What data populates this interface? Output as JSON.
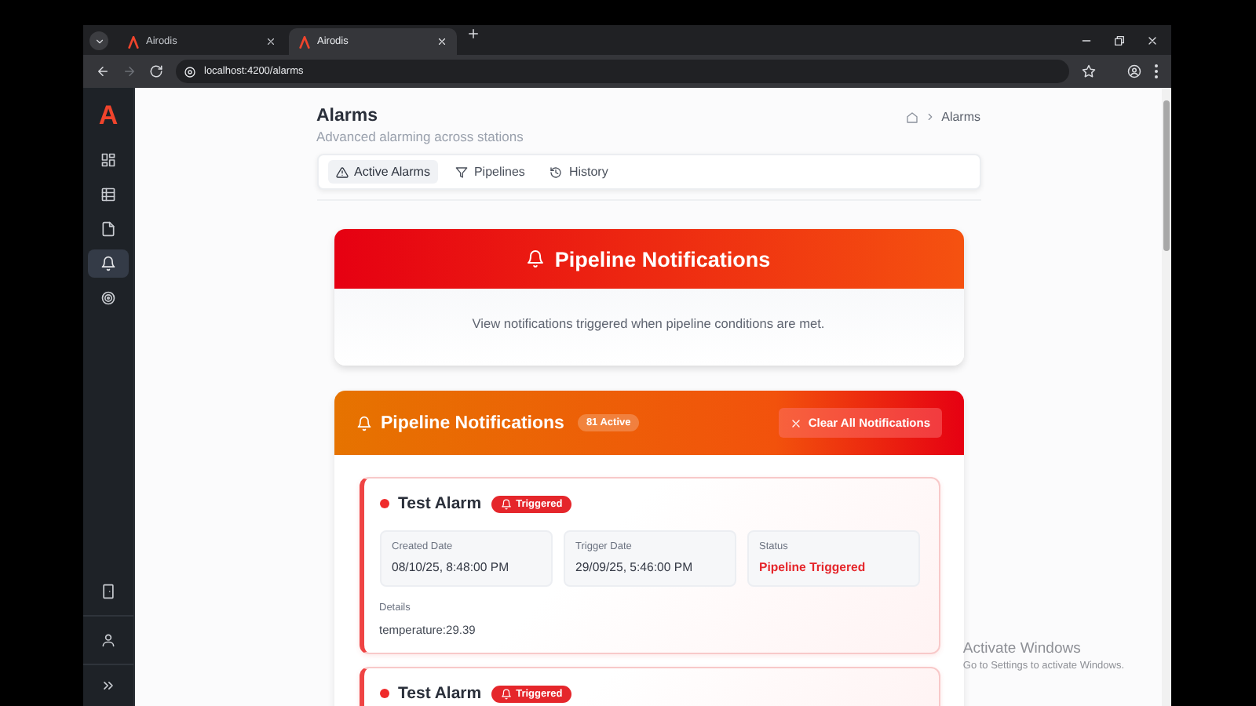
{
  "browser": {
    "tabs": [
      {
        "title": "Airodis",
        "selected": false
      },
      {
        "title": "Airodis",
        "selected": true
      }
    ],
    "url": "localhost:4200/alarms"
  },
  "sidebar": {
    "logo": "A",
    "items": [
      {
        "kind": "dashboard",
        "selected": false
      },
      {
        "kind": "table",
        "selected": false
      },
      {
        "kind": "document",
        "selected": false
      },
      {
        "kind": "bell",
        "selected": true
      },
      {
        "kind": "target",
        "selected": false
      }
    ]
  },
  "page": {
    "title": "Alarms",
    "subtitle": "Advanced alarming across stations",
    "breadcrumb": "Alarms"
  },
  "tabs": [
    {
      "label": "Active Alarms",
      "kind": "alert",
      "selected": true
    },
    {
      "label": "Pipelines",
      "kind": "filter",
      "selected": false
    },
    {
      "label": "History",
      "kind": "history",
      "selected": false
    }
  ],
  "intro": {
    "title": "Pipeline Notifications",
    "text": "View notifications triggered when pipeline conditions are met."
  },
  "notifications": {
    "title": "Pipeline Notifications",
    "badge": "81 Active",
    "clear_button": "Clear All Notifications",
    "alarms": [
      {
        "name": "Test Alarm",
        "badge": "Triggered",
        "fields": [
          {
            "label": "Created Date",
            "value": "08/10/25, 8:48:00 PM",
            "kind": "plain"
          },
          {
            "label": "Trigger Date",
            "value": "29/09/25, 5:46:00 PM",
            "kind": "plain"
          },
          {
            "label": "Status",
            "value": "Pipeline Triggered",
            "kind": "status"
          }
        ],
        "details_label": "Details",
        "details": "temperature:29.39"
      },
      {
        "name": "Test Alarm",
        "badge": "Triggered"
      }
    ]
  },
  "os_notice": {
    "title": "Activate Windows",
    "text": "Go to Settings to activate Windows."
  }
}
